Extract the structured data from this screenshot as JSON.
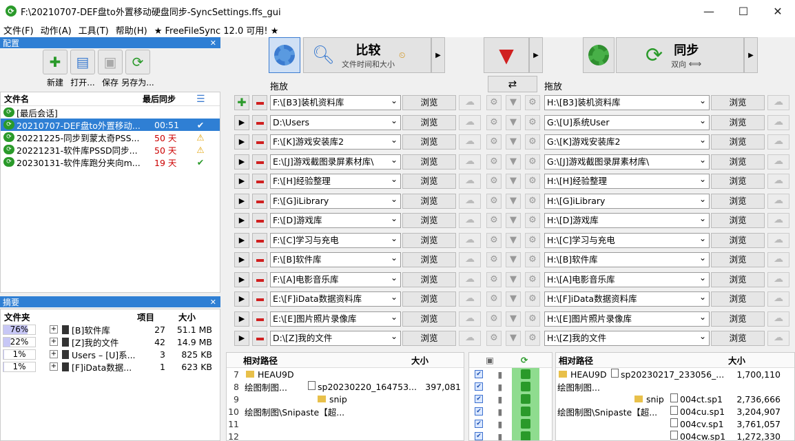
{
  "window": {
    "title": "F:\\20210707-DEF盘to外置移动硬盘同步-SyncSettings.ffs_gui",
    "minimize": "—",
    "maximize": "☐",
    "close": "✕"
  },
  "menu": [
    "文件(F)",
    "动作(A)",
    "工具(T)",
    "帮助(H)",
    "★ FreeFileSync 12.0 可用! ★"
  ],
  "config_panel": {
    "title": "配置",
    "tools": [
      {
        "label": "新建",
        "icon": "new-icon"
      },
      {
        "label": "打开...",
        "icon": "open-icon"
      },
      {
        "label": "保存",
        "icon": "save-icon"
      },
      {
        "label": "另存为...",
        "icon": "save-as-icon"
      }
    ],
    "headers": {
      "name": "文件名",
      "last_sync": "最后同步"
    },
    "rows": [
      {
        "name": "[最后会话]",
        "time": "",
        "status": ""
      },
      {
        "name": "20210707-DEF盘to外置移动...",
        "time": "00:51",
        "status": "✔"
      },
      {
        "name": "20221225-同步到蒙太奇PSS...",
        "time": "50 天",
        "status": "⚠"
      },
      {
        "name": "20221231-软件库PSSD同步...",
        "time": "50 天",
        "status": "⚠"
      },
      {
        "name": "20230131-软件库跑分夹向m...",
        "time": "19 天",
        "status": "✔"
      }
    ]
  },
  "summary_panel": {
    "title": "摘要",
    "headers": {
      "folder": "文件夹",
      "items": "项目",
      "size": "大小"
    },
    "rows": [
      {
        "pct": "76%",
        "pct_value": 76,
        "name": "[B]软件库",
        "count": "27",
        "size": "51.1 MB"
      },
      {
        "pct": "22%",
        "pct_value": 22,
        "name": "[Z]我的文件",
        "count": "42",
        "size": "14.9 MB"
      },
      {
        "pct": "1%",
        "pct_value": 1,
        "name": "Users – [U]系...",
        "count": "3",
        "size": "825 KB"
      },
      {
        "pct": "1%",
        "pct_value": 1,
        "name": "[F]iData数据...",
        "count": "1",
        "size": "623 KB"
      }
    ]
  },
  "toolbar": {
    "compare_title": "比较",
    "compare_sub": "文件时间和大小",
    "sync_title": "同步",
    "sync_sub": "双向"
  },
  "pairs": {
    "left_label": "拖放",
    "right_label": "拖放",
    "browse": "浏览",
    "rows": [
      {
        "left": "F:\\[B3]装机资料库",
        "right": "H:\\[B3]装机资料库"
      },
      {
        "left": "D:\\Users",
        "right": "G:\\[U]系统User"
      },
      {
        "left": "F:\\[K]游戏安装库2",
        "right": "G:\\[K]游戏安装库2"
      },
      {
        "left": "E:\\[J]游戏截图录屏素材库\\",
        "right": "G:\\[J]游戏截图录屏素材库\\"
      },
      {
        "left": "F:\\[H]经验整理",
        "right": "H:\\[H]经验整理"
      },
      {
        "left": "F:\\[G]iLibrary",
        "right": "H:\\[G]iLibrary"
      },
      {
        "left": "F:\\[D]游戏库",
        "right": "H:\\[D]游戏库"
      },
      {
        "left": "F:\\[C]学习与充电",
        "right": "H:\\[C]学习与充电"
      },
      {
        "left": "F:\\[B]软件库",
        "right": "H:\\[B]软件库"
      },
      {
        "left": "F:\\[A]电影音乐库",
        "right": "H:\\[A]电影音乐库"
      },
      {
        "left": "E:\\[F]iData数据资料库",
        "right": "H:\\[F]iData数据资料库"
      },
      {
        "left": "E:\\[E]图片照片录像库",
        "right": "H:\\[E]图片照片录像库"
      },
      {
        "left": "D:\\[Z]我的文件",
        "right": "H:\\[Z]我的文件"
      }
    ]
  },
  "left_grid": {
    "headers": {
      "path": "相对路径",
      "size": "大小"
    },
    "rows": [
      {
        "n": "7",
        "path": "HEAU9D",
        "file": "",
        "size": ""
      },
      {
        "n": "8",
        "path": "绘图制图...",
        "file": "sp20230220_164753...",
        "size": "397,081"
      },
      {
        "n": "9",
        "path": "",
        "file": "snip",
        "size": ""
      },
      {
        "n": "10",
        "path": "绘图制图\\Snipaste【超...",
        "file": "",
        "size": ""
      },
      {
        "n": "11",
        "path": "",
        "file": "",
        "size": ""
      },
      {
        "n": "12",
        "path": "",
        "file": "",
        "size": ""
      }
    ]
  },
  "right_grid": {
    "headers": {
      "path": "相对路径",
      "size": "大小"
    },
    "rows": [
      {
        "path": "HEAU9D",
        "file": "sp20230217_233056_...",
        "size": "1,700,110"
      },
      {
        "path": "绘图制图...",
        "file": "",
        "size": ""
      },
      {
        "path": "snip",
        "file": "004ct.sp1",
        "size": "2,736,666"
      },
      {
        "path": "绘图制图\\Snipaste【超...",
        "file": "004cu.sp1",
        "size": "3,204,907"
      },
      {
        "path": "",
        "file": "004cv.sp1",
        "size": "3,761,057"
      },
      {
        "path": "",
        "file": "004cw.sp1",
        "size": "1,272,330"
      }
    ]
  }
}
